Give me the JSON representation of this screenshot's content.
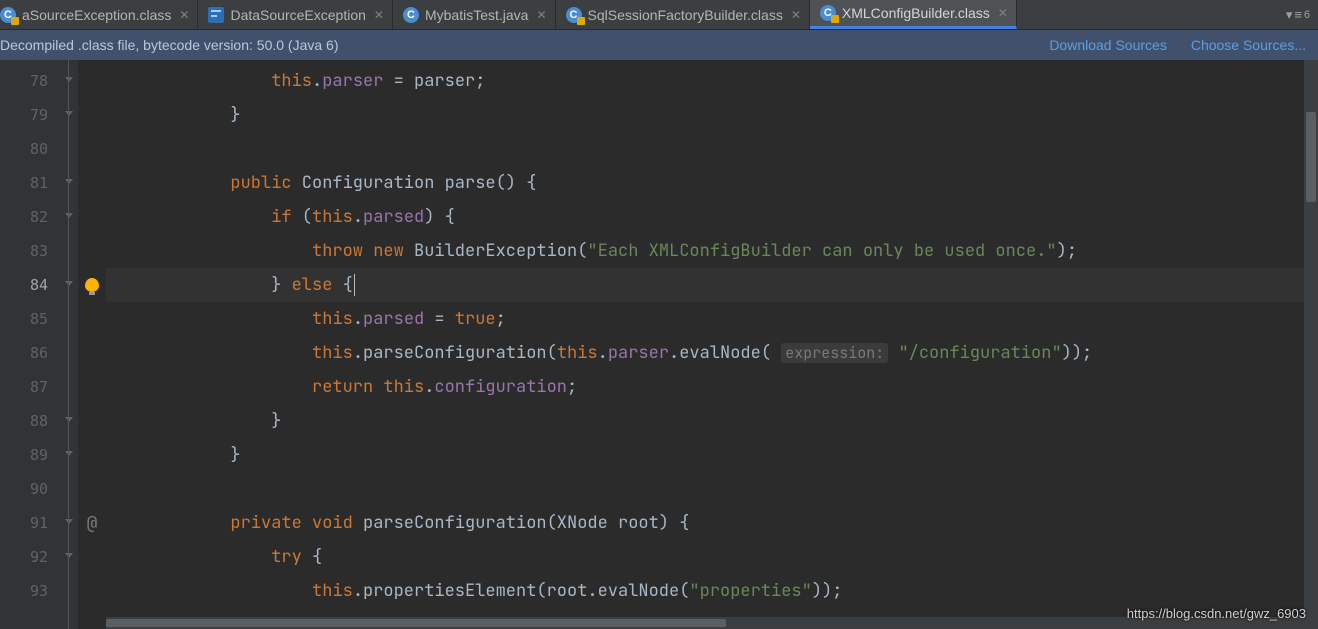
{
  "tabs": [
    {
      "label": "aSourceException.class",
      "icon": "class",
      "active": false
    },
    {
      "label": "DataSourceException",
      "icon": "blue",
      "active": false
    },
    {
      "label": "MybatisTest.java",
      "icon": "java",
      "active": false
    },
    {
      "label": "SqlSessionFactoryBuilder.class",
      "icon": "class",
      "active": false
    },
    {
      "label": "XMLConfigBuilder.class",
      "icon": "class",
      "active": true
    }
  ],
  "tabs_more_count": "6",
  "banner": {
    "message": "Decompiled .class file, bytecode version: 50.0 (Java 6)",
    "link1": "Download Sources",
    "link2": "Choose Sources..."
  },
  "gutter_lines": [
    "78",
    "79",
    "80",
    "81",
    "82",
    "83",
    "84",
    "85",
    "86",
    "87",
    "88",
    "89",
    "90",
    "91",
    "92",
    "93"
  ],
  "current_line_index": 6,
  "code_lines": [
    {
      "tokens": [
        {
          "t": "",
          "c": "id",
          "pad": 16
        },
        {
          "t": "this",
          "c": "kw"
        },
        {
          "t": ".",
          "c": "id"
        },
        {
          "t": "parser",
          "c": "field"
        },
        {
          "t": " = parser;",
          "c": "id"
        }
      ]
    },
    {
      "tokens": [
        {
          "t": "",
          "c": "id",
          "pad": 12
        },
        {
          "t": "}",
          "c": "id"
        }
      ]
    },
    {
      "tokens": [
        {
          "t": "",
          "c": "id"
        }
      ]
    },
    {
      "tokens": [
        {
          "t": "",
          "c": "id",
          "pad": 12
        },
        {
          "t": "public",
          "c": "kw"
        },
        {
          "t": " Configuration ",
          "c": "id"
        },
        {
          "t": "parse",
          "c": "id"
        },
        {
          "t": "() {",
          "c": "id"
        }
      ]
    },
    {
      "tokens": [
        {
          "t": "",
          "c": "id",
          "pad": 16
        },
        {
          "t": "if",
          "c": "kw"
        },
        {
          "t": " (",
          "c": "id"
        },
        {
          "t": "this",
          "c": "kw"
        },
        {
          "t": ".",
          "c": "id"
        },
        {
          "t": "parsed",
          "c": "field"
        },
        {
          "t": ") {",
          "c": "id"
        }
      ]
    },
    {
      "tokens": [
        {
          "t": "",
          "c": "id",
          "pad": 20
        },
        {
          "t": "throw new",
          "c": "kw"
        },
        {
          "t": " BuilderException(",
          "c": "id"
        },
        {
          "t": "\"Each XMLConfigBuilder can only be used once.\"",
          "c": "str"
        },
        {
          "t": ");",
          "c": "id"
        }
      ]
    },
    {
      "tokens": [
        {
          "t": "",
          "c": "id",
          "pad": 16
        },
        {
          "t": "} ",
          "c": "id"
        },
        {
          "t": "else",
          "c": "kw"
        },
        {
          "t": " {",
          "c": "id"
        }
      ],
      "cursor": true
    },
    {
      "tokens": [
        {
          "t": "",
          "c": "id",
          "pad": 20
        },
        {
          "t": "this",
          "c": "kw"
        },
        {
          "t": ".",
          "c": "id"
        },
        {
          "t": "parsed",
          "c": "field"
        },
        {
          "t": " = ",
          "c": "id"
        },
        {
          "t": "true",
          "c": "lit"
        },
        {
          "t": ";",
          "c": "id"
        }
      ]
    },
    {
      "tokens": [
        {
          "t": "",
          "c": "id",
          "pad": 20
        },
        {
          "t": "this",
          "c": "kw"
        },
        {
          "t": ".parseConfiguration(",
          "c": "id"
        },
        {
          "t": "this",
          "c": "kw"
        },
        {
          "t": ".",
          "c": "id"
        },
        {
          "t": "parser",
          "c": "field"
        },
        {
          "t": ".evalNode( ",
          "c": "id"
        },
        {
          "t": "expression:",
          "c": "hint"
        },
        {
          "t": " ",
          "c": "id"
        },
        {
          "t": "\"/configuration\"",
          "c": "str"
        },
        {
          "t": "));",
          "c": "id"
        }
      ]
    },
    {
      "tokens": [
        {
          "t": "",
          "c": "id",
          "pad": 20
        },
        {
          "t": "return this",
          "c": "kw"
        },
        {
          "t": ".",
          "c": "id"
        },
        {
          "t": "configuration",
          "c": "field"
        },
        {
          "t": ";",
          "c": "id"
        }
      ]
    },
    {
      "tokens": [
        {
          "t": "",
          "c": "id",
          "pad": 16
        },
        {
          "t": "}",
          "c": "id"
        }
      ]
    },
    {
      "tokens": [
        {
          "t": "",
          "c": "id",
          "pad": 12
        },
        {
          "t": "}",
          "c": "id"
        }
      ]
    },
    {
      "tokens": [
        {
          "t": "",
          "c": "id"
        }
      ]
    },
    {
      "tokens": [
        {
          "t": "",
          "c": "id",
          "pad": 12
        },
        {
          "t": "private void",
          "c": "kw"
        },
        {
          "t": " parseConfiguration(XNode root) {",
          "c": "id"
        }
      ]
    },
    {
      "tokens": [
        {
          "t": "",
          "c": "id",
          "pad": 16
        },
        {
          "t": "try",
          "c": "kw"
        },
        {
          "t": " {",
          "c": "id"
        }
      ]
    },
    {
      "tokens": [
        {
          "t": "",
          "c": "id",
          "pad": 20
        },
        {
          "t": "this",
          "c": "kw"
        },
        {
          "t": ".propertiesElement(root.evalNode(",
          "c": "id"
        },
        {
          "t": "\"properties\"",
          "c": "str"
        },
        {
          "t": "));",
          "c": "id"
        }
      ]
    }
  ],
  "fold_marks": [
    0,
    1,
    3,
    4,
    6,
    10,
    11,
    13,
    14
  ],
  "annotations": {
    "6": "bulb",
    "13": "@"
  },
  "watermark": "https://blog.csdn.net/gwz_6903"
}
